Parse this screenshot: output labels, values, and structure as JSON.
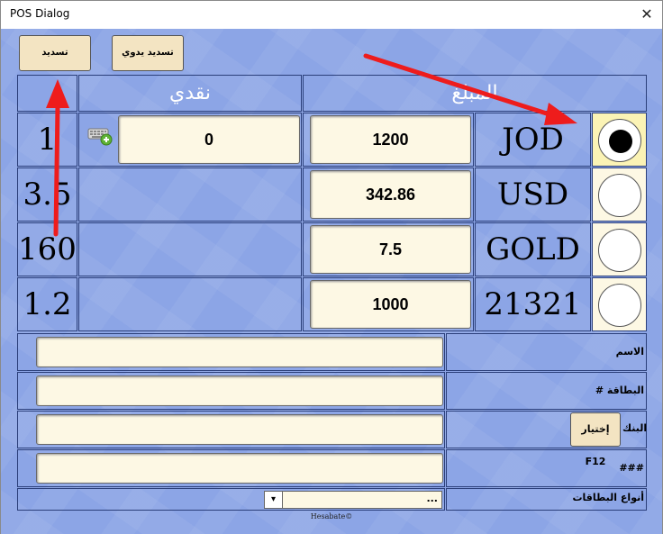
{
  "window": {
    "title": "POS Dialog",
    "close_glyph": "✕"
  },
  "toolbar": {
    "pay_label": "تسديد",
    "manual_pay_label": "تسديد يدوي"
  },
  "table": {
    "headers": {
      "cash": "نقدي",
      "amount": "المبلغ"
    },
    "rows": [
      {
        "rate": "1",
        "cash": "0",
        "amount": "1200",
        "currency": "JOD",
        "selected": true
      },
      {
        "rate": "3.5",
        "cash": "",
        "amount": "342.86",
        "currency": "USD",
        "selected": false
      },
      {
        "rate": "160",
        "cash": "",
        "amount": "7.5",
        "currency": "GOLD",
        "selected": false
      },
      {
        "rate": "1.2",
        "cash": "",
        "amount": "1000",
        "currency": "21321",
        "selected": false
      }
    ]
  },
  "form": {
    "name_label": "الاسم",
    "name_value": "",
    "card_label": "# البطاقة",
    "card_value": "",
    "bank_label": "البنك",
    "bank_choose_button": "إختيار F12",
    "bank_value": "",
    "hash_label": "###",
    "hash_value": "",
    "card_types_label": "أنواع البطاقات",
    "card_types_selected": "..."
  },
  "footer": {
    "copyright": "Hesabate©"
  },
  "icons": {
    "keyboard": "keyboard-add-icon",
    "radio": "radio-icon",
    "dropdown": "chevron-down-icon"
  },
  "colors": {
    "background": "#8ca5e6",
    "field": "#fdf8e4",
    "button": "#f3e4c2",
    "arrow": "#ee1c1c"
  }
}
